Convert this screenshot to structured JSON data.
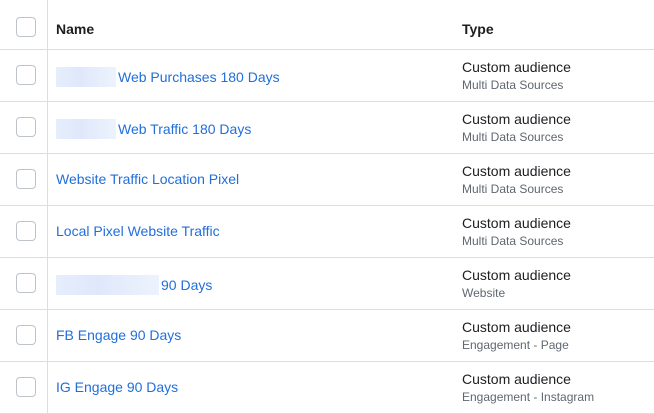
{
  "header": {
    "name_label": "Name",
    "type_label": "Type"
  },
  "rows": [
    {
      "name_link": "Web Purchases 180 Days",
      "type": "Custom audience",
      "source": "Multi Data Sources"
    },
    {
      "name_link": "Web Traffic 180 Days",
      "type": "Custom audience",
      "source": "Multi Data Sources"
    },
    {
      "name_link": "Website Traffic Location Pixel",
      "type": "Custom audience",
      "source": "Multi Data Sources"
    },
    {
      "name_link": "Local Pixel Website Traffic",
      "type": "Custom audience",
      "source": "Multi Data Sources"
    },
    {
      "name_link": "90 Days",
      "type": "Custom audience",
      "source": "Website"
    },
    {
      "name_link": "FB Engage 90 Days",
      "type": "Custom audience",
      "source": "Engagement - Page"
    },
    {
      "name_link": "IG Engage 90 Days",
      "type": "Custom audience",
      "source": "Engagement - Instagram"
    }
  ],
  "colors": {
    "link": "#216fdb",
    "border": "#dadde1",
    "secondary_text": "#606770"
  }
}
